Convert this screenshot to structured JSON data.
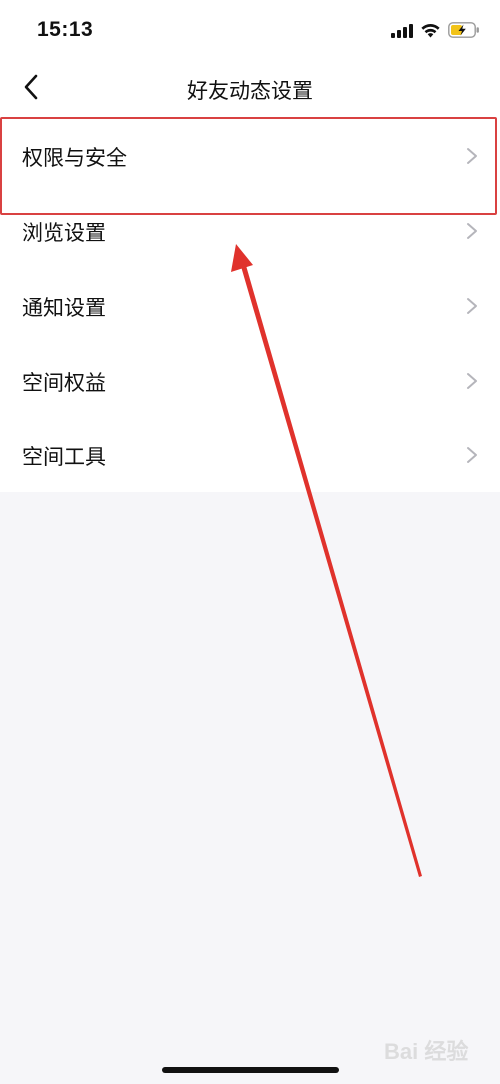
{
  "status_bar": {
    "time": "15:13",
    "icons": [
      "cellular-signal-icon",
      "wifi-icon",
      "battery-charging-icon"
    ]
  },
  "nav": {
    "title": "好友动态设置",
    "back_icon": "chevron-left-icon"
  },
  "settings": {
    "items": [
      {
        "label": "权限与安全"
      },
      {
        "label": "浏览设置"
      },
      {
        "label": "通知设置"
      },
      {
        "label": "空间权益"
      },
      {
        "label": "空间工具"
      }
    ]
  },
  "annotation": {
    "highlight_color": "#d94141",
    "arrow_color": "#e0322c"
  },
  "watermark": {
    "text": "Bai 经验"
  },
  "colors": {
    "background": "#f6f6f9",
    "surface": "#ffffff",
    "chevron": "#b5b5bb",
    "battery_accent": "#f2c318"
  }
}
